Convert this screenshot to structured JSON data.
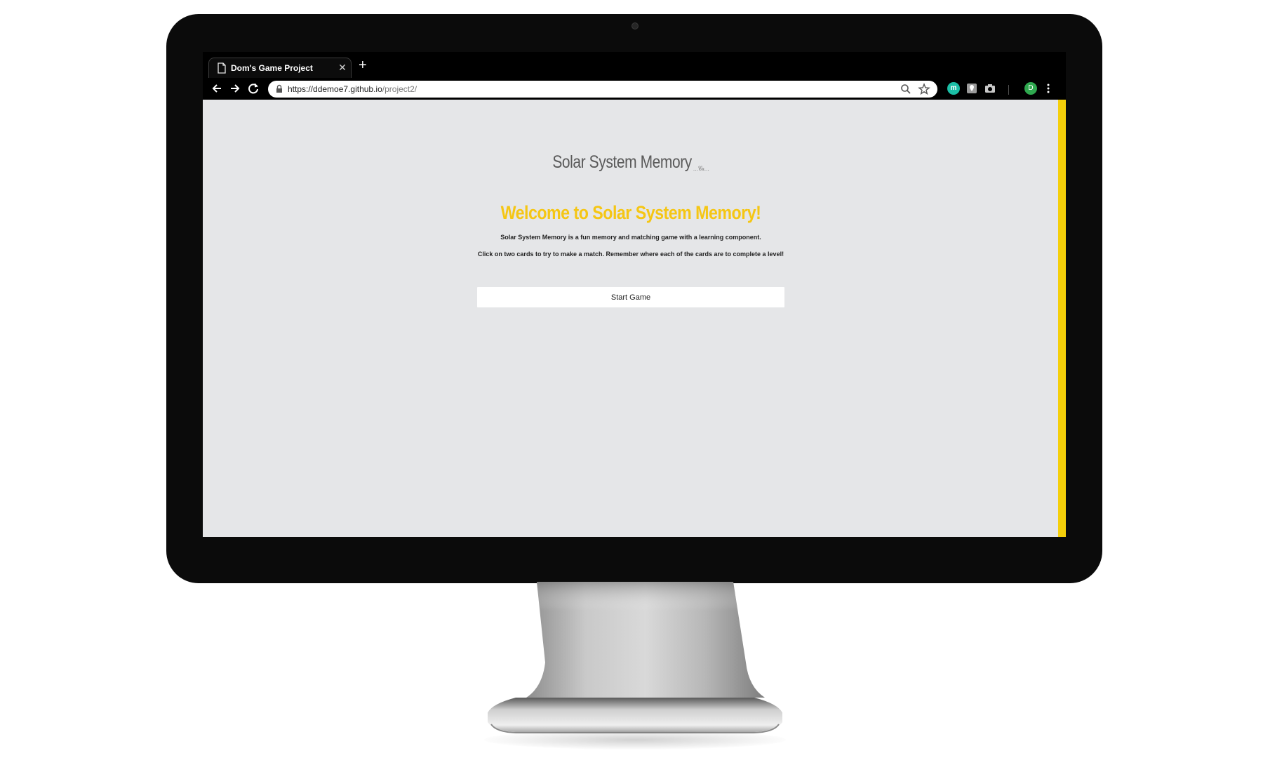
{
  "browser": {
    "tab": {
      "title": "Dom's Game Project",
      "close_glyph": "✕",
      "icon": "page-icon"
    },
    "new_tab_glyph": "+",
    "address": {
      "host": "https://ddemoe7.github.io",
      "path": "/project2/"
    },
    "profile_initial": "D",
    "extension_m_label": "m"
  },
  "page": {
    "logo_text": "Solar System Memory",
    "logo_mark": "…𝒞𝒶…",
    "heading": "Welcome to Solar System Memory!",
    "intro_line_1": "Solar System Memory is a fun memory and matching game with a learning component.",
    "intro_line_2": "Click on two cards to try to make a match. Remember where each of the cards are to complete a level!",
    "start_button": "Start Game"
  },
  "colors": {
    "accent_yellow": "#f5c614",
    "scrollbar_yellow": "#f5cf0a",
    "page_background": "#e5e6e8",
    "monitor_bezel": "#0b0b0b"
  }
}
